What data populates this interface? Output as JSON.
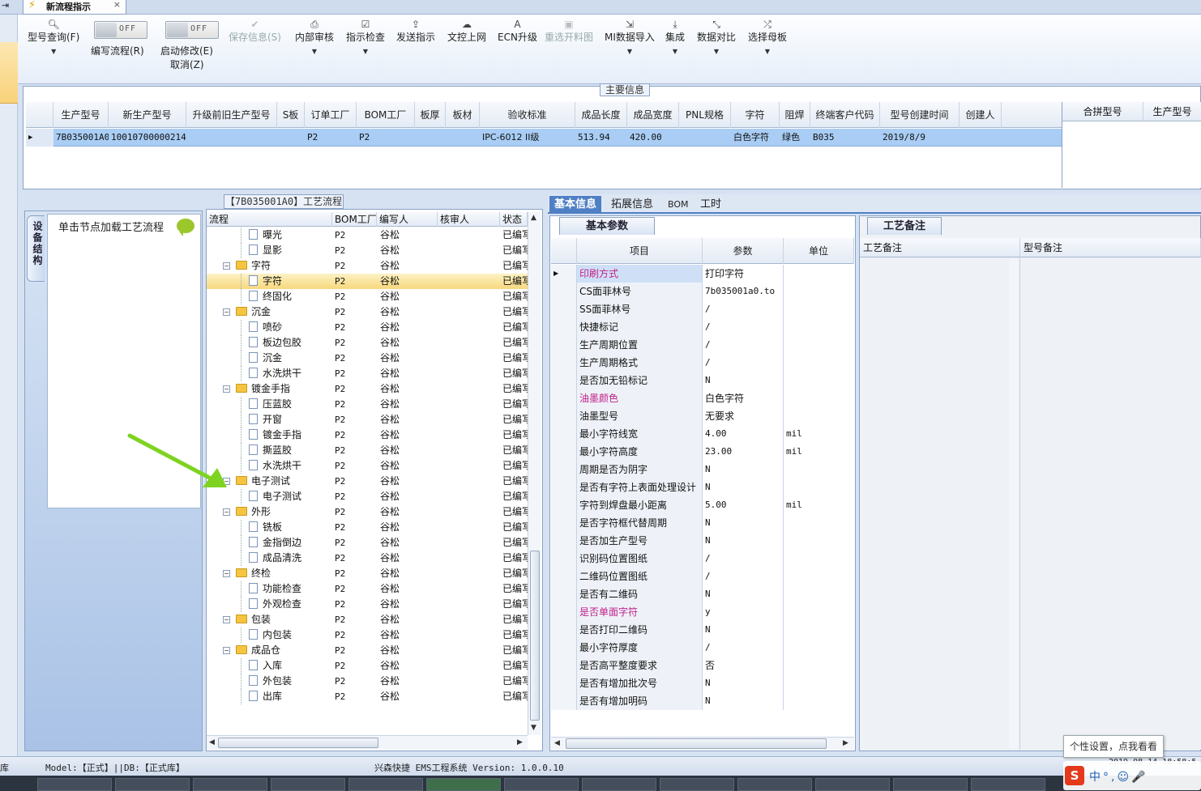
{
  "window": {
    "tab_title": "新流程指示"
  },
  "ribbon": {
    "buttons": [
      {
        "label": "型号查询(F)",
        "icon": "search-icon",
        "dropdown": true
      },
      {
        "label": "保存信息(S)",
        "icon": "check-icon",
        "disabled": true
      },
      {
        "label": "内部审核",
        "icon": "print-icon",
        "dropdown": true
      },
      {
        "label": "指示检查",
        "icon": "checklist-icon",
        "dropdown": true
      },
      {
        "label": "发送指示",
        "icon": "upload-icon"
      },
      {
        "label": "文控上网",
        "icon": "cloud-upload-icon"
      },
      {
        "label": "ECN升级",
        "icon": "font-icon"
      },
      {
        "label": "重选开料图",
        "icon": "image-icon",
        "disabled": true
      },
      {
        "label": "MI数据导入",
        "icon": "import-icon",
        "dropdown": true
      },
      {
        "label": "集成",
        "icon": "download-icon",
        "dropdown": true
      },
      {
        "label": "数据对比",
        "icon": "compare-icon",
        "dropdown": true
      },
      {
        "label": "选择母板",
        "icon": "shuffle-icon",
        "dropdown": true
      }
    ],
    "toggle_write": {
      "state": "OFF",
      "label": "编写流程(R)"
    },
    "toggle_modify": {
      "state": "OFF",
      "label": "启动修改(E)",
      "sub": "取消(Z)"
    }
  },
  "main_info": {
    "title": "主要信息",
    "columns": [
      "生产型号",
      "新生产型号",
      "升级前旧生产型号",
      "S板",
      "订单工厂",
      "BOM工厂",
      "板厚",
      "板材",
      "验收标准",
      "成品长度",
      "成品宽度",
      "PNL规格",
      "字符",
      "阻焊",
      "终端客户代码",
      "型号创建时间",
      "创建人"
    ],
    "row": [
      "7B035001A0",
      "10010700000214",
      "",
      "",
      "P2",
      "P2",
      "",
      "",
      "IPC-6012 II级",
      "513.94",
      "420.00",
      "",
      "白色字符",
      "绿色",
      "B035",
      "2019/8/9",
      ""
    ],
    "merge_columns": [
      "合拼型号",
      "生产型号"
    ]
  },
  "left_dock": {
    "tab": "设备结构",
    "hint": "单击节点加载工艺流程"
  },
  "process": {
    "title": "【7B035001A0】工艺流程",
    "columns": [
      "流程",
      "BOM工厂",
      "编写人",
      "核审人",
      "状态"
    ],
    "rows": [
      {
        "level": 2,
        "name": "曝光",
        "bom": "P2",
        "writer": "谷松",
        "checker": "",
        "status": "已编写"
      },
      {
        "level": 2,
        "name": "显影",
        "bom": "P2",
        "writer": "谷松",
        "checker": "",
        "status": "已编写"
      },
      {
        "level": 1,
        "name": "字符",
        "bom": "P2",
        "writer": "谷松",
        "checker": "",
        "status": "已编写"
      },
      {
        "level": 2,
        "name": "字符",
        "bom": "P2",
        "writer": "谷松",
        "checker": "",
        "status": "已编写",
        "selected": true
      },
      {
        "level": 2,
        "name": "终固化",
        "bom": "P2",
        "writer": "谷松",
        "checker": "",
        "status": "已编写"
      },
      {
        "level": 1,
        "name": "沉金",
        "bom": "P2",
        "writer": "谷松",
        "checker": "",
        "status": "已编写"
      },
      {
        "level": 2,
        "name": "喷砂",
        "bom": "P2",
        "writer": "谷松",
        "checker": "",
        "status": "已编写"
      },
      {
        "level": 2,
        "name": "板边包胶",
        "bom": "P2",
        "writer": "谷松",
        "checker": "",
        "status": "已编写"
      },
      {
        "level": 2,
        "name": "沉金",
        "bom": "P2",
        "writer": "谷松",
        "checker": "",
        "status": "已编写"
      },
      {
        "level": 2,
        "name": "水洗烘干",
        "bom": "P2",
        "writer": "谷松",
        "checker": "",
        "status": "已编写"
      },
      {
        "level": 1,
        "name": "镀金手指",
        "bom": "P2",
        "writer": "谷松",
        "checker": "",
        "status": "已编写"
      },
      {
        "level": 2,
        "name": "压蓝胶",
        "bom": "P2",
        "writer": "谷松",
        "checker": "",
        "status": "已编写"
      },
      {
        "level": 2,
        "name": "开窗",
        "bom": "P2",
        "writer": "谷松",
        "checker": "",
        "status": "已编写"
      },
      {
        "level": 2,
        "name": "镀金手指",
        "bom": "P2",
        "writer": "谷松",
        "checker": "",
        "status": "已编写"
      },
      {
        "level": 2,
        "name": "撕蓝胶",
        "bom": "P2",
        "writer": "谷松",
        "checker": "",
        "status": "已编写"
      },
      {
        "level": 2,
        "name": "水洗烘干",
        "bom": "P2",
        "writer": "谷松",
        "checker": "",
        "status": "已编写"
      },
      {
        "level": 1,
        "name": "电子测试",
        "bom": "P2",
        "writer": "谷松",
        "checker": "",
        "status": "已编写"
      },
      {
        "level": 2,
        "name": "电子测试",
        "bom": "P2",
        "writer": "谷松",
        "checker": "",
        "status": "已编写"
      },
      {
        "level": 1,
        "name": "外形",
        "bom": "P2",
        "writer": "谷松",
        "checker": "",
        "status": "已编写"
      },
      {
        "level": 2,
        "name": "铣板",
        "bom": "P2",
        "writer": "谷松",
        "checker": "",
        "status": "已编写"
      },
      {
        "level": 2,
        "name": "金指倒边",
        "bom": "P2",
        "writer": "谷松",
        "checker": "",
        "status": "已编写"
      },
      {
        "level": 2,
        "name": "成品清洗",
        "bom": "P2",
        "writer": "谷松",
        "checker": "",
        "status": "已编写"
      },
      {
        "level": 1,
        "name": "终检",
        "bom": "P2",
        "writer": "谷松",
        "checker": "",
        "status": "已编写"
      },
      {
        "level": 2,
        "name": "功能检查",
        "bom": "P2",
        "writer": "谷松",
        "checker": "",
        "status": "已编写"
      },
      {
        "level": 2,
        "name": "外观检查",
        "bom": "P2",
        "writer": "谷松",
        "checker": "",
        "status": "已编写"
      },
      {
        "level": 1,
        "name": "包装",
        "bom": "P2",
        "writer": "谷松",
        "checker": "",
        "status": "已编写"
      },
      {
        "level": 2,
        "name": "内包装",
        "bom": "P2",
        "writer": "谷松",
        "checker": "",
        "status": "已编写"
      },
      {
        "level": 1,
        "name": "成品仓",
        "bom": "P2",
        "writer": "谷松",
        "checker": "",
        "status": "已编写"
      },
      {
        "level": 2,
        "name": "入库",
        "bom": "P2",
        "writer": "谷松",
        "checker": "",
        "status": "已编写"
      },
      {
        "level": 2,
        "name": "外包装",
        "bom": "P2",
        "writer": "谷松",
        "checker": "",
        "status": "已编写"
      },
      {
        "level": 2,
        "name": "出库",
        "bom": "P2",
        "writer": "谷松",
        "checker": "",
        "status": "已编写"
      }
    ]
  },
  "right_tabs": [
    "基本信息",
    "拓展信息",
    "BOM",
    "工时"
  ],
  "params": {
    "title": "基本参数",
    "columns": [
      "项目",
      "参数",
      "单位"
    ],
    "rows": [
      {
        "item": "印刷方式",
        "value": "打印字符",
        "unit": "",
        "hl": true
      },
      {
        "item": "CS面菲林号",
        "value": "7b035001a0.to",
        "unit": ""
      },
      {
        "item": "SS面菲林号",
        "value": "/",
        "unit": ""
      },
      {
        "item": "快捷标记",
        "value": "/",
        "unit": ""
      },
      {
        "item": "生产周期位置",
        "value": "/",
        "unit": ""
      },
      {
        "item": "生产周期格式",
        "value": "/",
        "unit": ""
      },
      {
        "item": "是否加无铅标记",
        "value": "N",
        "unit": ""
      },
      {
        "item": "油墨颜色",
        "value": "白色字符",
        "unit": "",
        "hl": true
      },
      {
        "item": "油墨型号",
        "value": "无要求",
        "unit": ""
      },
      {
        "item": "最小字符线宽",
        "value": "4.00",
        "unit": "mil"
      },
      {
        "item": "最小字符高度",
        "value": "23.00",
        "unit": "mil"
      },
      {
        "item": "周期是否为阴字",
        "value": "N",
        "unit": ""
      },
      {
        "item": "是否有字符上表面处理设计",
        "value": "N",
        "unit": ""
      },
      {
        "item": "字符到焊盘最小距离",
        "value": "5.00",
        "unit": "mil"
      },
      {
        "item": "是否字符框代替周期",
        "value": "N",
        "unit": ""
      },
      {
        "item": "是否加生产型号",
        "value": "N",
        "unit": ""
      },
      {
        "item": "识别码位置图纸",
        "value": "/",
        "unit": ""
      },
      {
        "item": "二维码位置图纸",
        "value": "/",
        "unit": ""
      },
      {
        "item": "是否有二维码",
        "value": "N",
        "unit": ""
      },
      {
        "item": "是否单面字符",
        "value": "y",
        "unit": "",
        "hl": true
      },
      {
        "item": "是否打印二维码",
        "value": "N",
        "unit": ""
      },
      {
        "item": "最小字符厚度",
        "value": "/",
        "unit": ""
      },
      {
        "item": "是否高平整度要求",
        "value": "否",
        "unit": ""
      },
      {
        "item": "是否有增加批次号",
        "value": "N",
        "unit": ""
      },
      {
        "item": "是否有增加明码",
        "value": "N",
        "unit": ""
      }
    ]
  },
  "remarks": {
    "title": "工艺备注",
    "col1": "工艺备注",
    "col2": "型号备注"
  },
  "status": {
    "left": "库",
    "model": "Model:【正式】||DB:【正式库】",
    "system": "兴森快捷 EMS工程系统 Version: 1.0.0.10",
    "clock": "2019-08-14 18:58:5",
    "tooltip": "个性设置，点我看看",
    "ime_chars": "中°,☺🎤"
  },
  "colors": {
    "accent": "#4f7fc4",
    "selection": "#a9cdf4",
    "highlight_item": "#c0208a",
    "arrow": "#7ed321"
  }
}
